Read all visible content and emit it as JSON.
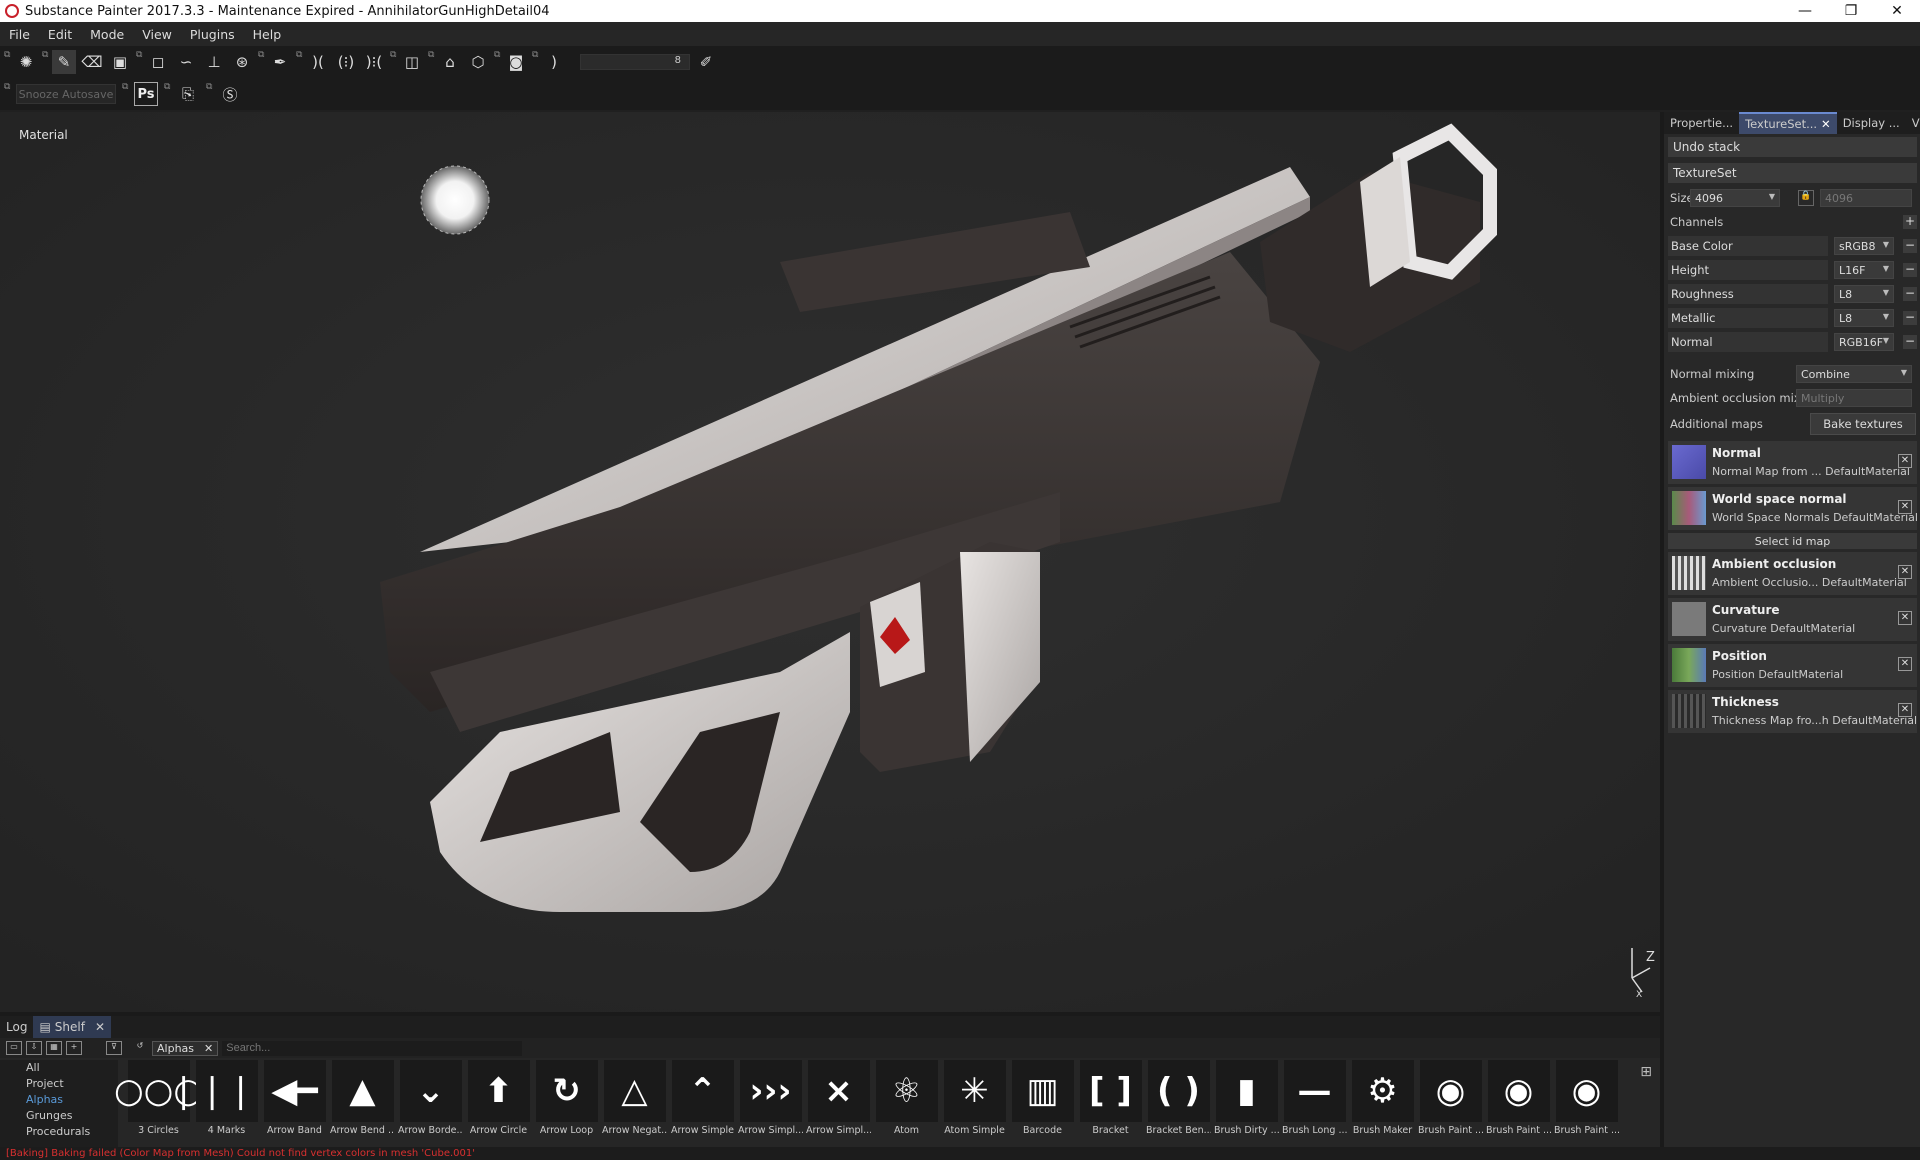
{
  "window": {
    "title": "Substance Painter 2017.3.3 - Maintenance Expired - AnnihilatorGunHighDetail04",
    "minimize": "—",
    "maximize": "❐",
    "close": "✕"
  },
  "menu": [
    "File",
    "Edit",
    "Mode",
    "View",
    "Plugins",
    "Help"
  ],
  "toolbar": {
    "size_value": "8",
    "snooze_label": "Snooze Autosave",
    "ps_label": "Ps"
  },
  "viewport": {
    "label": "Material",
    "axis_z": "Z",
    "axis_x": "X"
  },
  "right_panel": {
    "tabs": [
      "Propertie...",
      "TextureSet...",
      "Display ...",
      "Viewer"
    ],
    "undo_stack": "Undo stack",
    "texture_set": "TextureSet",
    "size_label": "Size",
    "size_value": "4096",
    "size_linked": "4096",
    "channels_label": "Channels",
    "add_symbol": "+",
    "channels": [
      {
        "name": "Base Color",
        "format": "sRGB8"
      },
      {
        "name": "Height",
        "format": "L16F"
      },
      {
        "name": "Roughness",
        "format": "L8"
      },
      {
        "name": "Metallic",
        "format": "L8"
      },
      {
        "name": "Normal",
        "format": "RGB16F"
      }
    ],
    "normal_mixing_label": "Normal mixing",
    "normal_mixing_value": "Combine",
    "ao_mixing_label": "Ambient occlusion mixing",
    "ao_mixing_value": "Multiply",
    "additional_maps_label": "Additional maps",
    "bake_button": "Bake textures",
    "select_id_map": "Select id map",
    "maps": [
      {
        "title": "Normal",
        "sub": "Normal Map from ... DefaultMaterial",
        "color": "#5a5ab8"
      },
      {
        "title": "World space normal",
        "sub": "World Space Normals DefaultMaterial",
        "color": "#6a9a5a"
      },
      {
        "title": "Ambient occlusion",
        "sub": "Ambient Occlusio... DefaultMaterial",
        "color": "#bbbbbb"
      },
      {
        "title": "Curvature",
        "sub": "Curvature DefaultMaterial",
        "color": "#7a7a7a"
      },
      {
        "title": "Position",
        "sub": "Position DefaultMaterial",
        "color": "#5a8a4a"
      },
      {
        "title": "Thickness",
        "sub": "Thickness Map fro...h DefaultMaterial",
        "color": "#3a3a3a"
      }
    ]
  },
  "shelf": {
    "tabs": [
      "Log",
      "Shelf"
    ],
    "filter_tag": "Alphas",
    "search_placeholder": "Search...",
    "categories": [
      "All",
      "Project",
      "Alphas",
      "Grunges",
      "Procedurals"
    ],
    "selected_category": "Alphas",
    "items": [
      {
        "label": "3 Circles",
        "glyph": "○○○"
      },
      {
        "label": "4 Marks",
        "glyph": "❘❘❘❘"
      },
      {
        "label": "Arrow Band",
        "glyph": "◀━"
      },
      {
        "label": "Arrow Bend ...",
        "glyph": "▲"
      },
      {
        "label": "Arrow Borde...",
        "glyph": "⌄"
      },
      {
        "label": "Arrow Circle",
        "glyph": "⬆"
      },
      {
        "label": "Arrow Loop",
        "glyph": "↻"
      },
      {
        "label": "Arrow Negat...",
        "glyph": "△"
      },
      {
        "label": "Arrow Simple",
        "glyph": "⌃"
      },
      {
        "label": "Arrow Simpl...",
        "glyph": "›››"
      },
      {
        "label": "Arrow Simpl...",
        "glyph": "⨯"
      },
      {
        "label": "Atom",
        "glyph": "⚛"
      },
      {
        "label": "Atom Simple",
        "glyph": "✳"
      },
      {
        "label": "Barcode",
        "glyph": "▥"
      },
      {
        "label": "Bracket",
        "glyph": "[ ]"
      },
      {
        "label": "Bracket Ben...",
        "glyph": "( )"
      },
      {
        "label": "Brush Dirty ...",
        "glyph": "▮"
      },
      {
        "label": "Brush Long ...",
        "glyph": "—"
      },
      {
        "label": "Brush Maker",
        "glyph": "⚙"
      },
      {
        "label": "Brush Paint ...",
        "glyph": "◉"
      },
      {
        "label": "Brush Paint ...",
        "glyph": "◉"
      },
      {
        "label": "Brush Paint ...",
        "glyph": "◉"
      }
    ]
  },
  "status": "[Baking] Baking failed (Color Map from Mesh) Could not find vertex colors in mesh 'Cube.001'"
}
